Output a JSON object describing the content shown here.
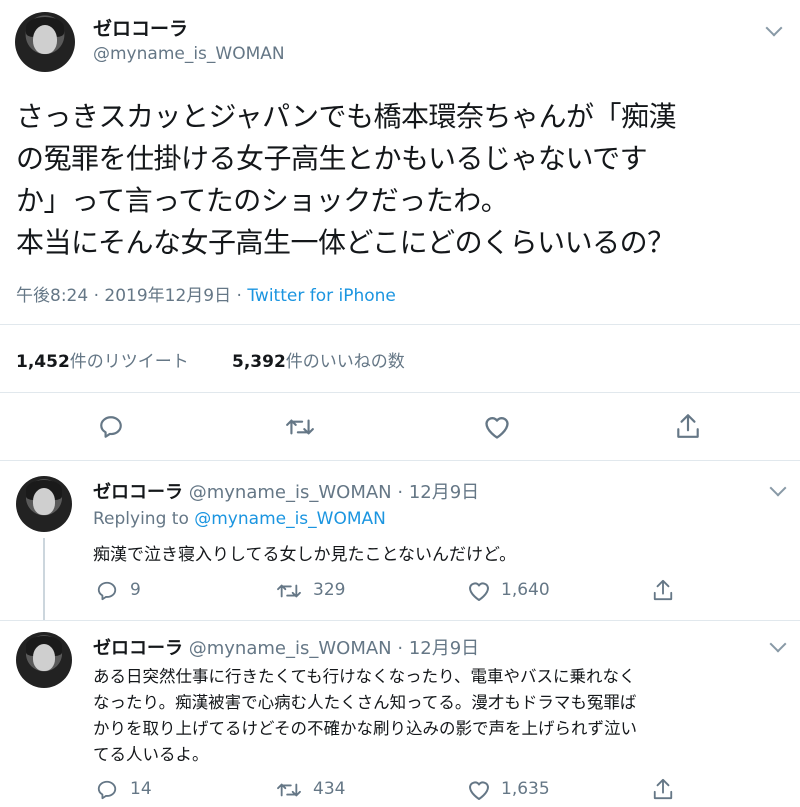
{
  "main_tweet": {
    "display_name": "ゼロコーラ",
    "handle": "@myname_is_WOMAN",
    "text_lines": [
      "さっきスカッとジャパンでも橋本環奈ちゃんが「痴漢",
      "の冤罪を仕掛ける女子高生とかもいるじゃないです",
      "か」って言ってたのショックだったわ。",
      "本当にそんな女子高生一体どこにどのくらいいるの？"
    ],
    "time": "午後8:24",
    "date": "2019年12月9日",
    "source": "Twitter for iPhone",
    "retweets_count": "1,452",
    "retweets_label": "件のリツイート",
    "likes_count": "5,392",
    "likes_label": "件のいいねの数"
  },
  "replies": [
    {
      "display_name": "ゼロコーラ",
      "handle": "@myname_is_WOMAN",
      "date": "12月9日",
      "replying_to_label": "Replying to",
      "replying_to_handle": "@myname_is_WOMAN",
      "text_lines": [
        "痴漢で泣き寝入りしてる女しか見たことないんだけど。"
      ],
      "reply_count": "9",
      "retweet_count": "329",
      "like_count": "1,640"
    },
    {
      "display_name": "ゼロコーラ",
      "handle": "@myname_is_WOMAN",
      "date": "12月9日",
      "text_lines": [
        "ある日突然仕事に行きたくても行けなくなったり、電車やバスに乗れなく",
        "なったり。痴漢被害で心病む人たくさん知ってる。漫才もドラマも冤罪ば",
        "かりを取り上げてるけどその不確かな刷り込みの影で声を上げられず泣い",
        "てる人いるよ。"
      ],
      "reply_count": "14",
      "retweet_count": "434",
      "like_count": "1,635"
    }
  ],
  "colors": {
    "link": "#1b95e0",
    "secondary": "#657786",
    "divider": "#e1e8ed",
    "text": "#14171a"
  }
}
